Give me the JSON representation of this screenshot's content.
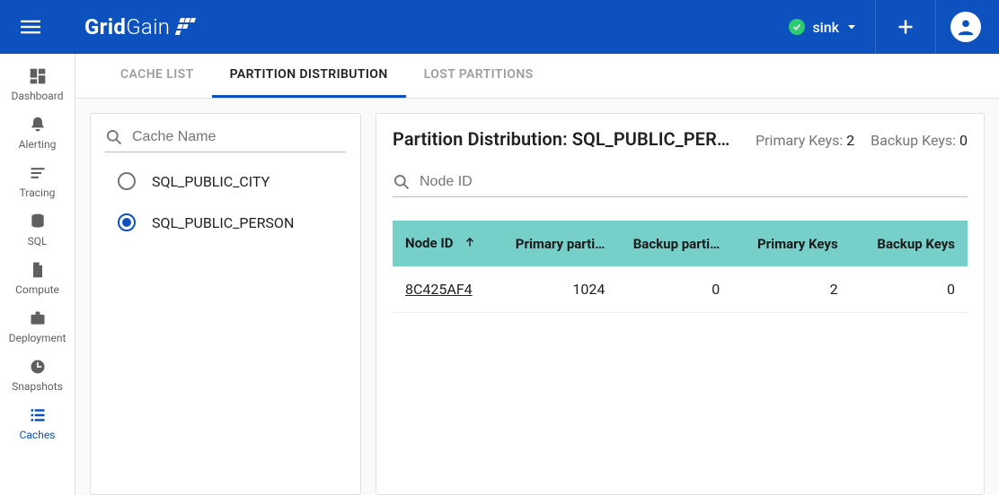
{
  "header": {
    "brand_strong": "Grid",
    "brand_light": "Gain",
    "cluster_name": "sink"
  },
  "leftnav": {
    "items": [
      {
        "label": "Dashboard",
        "icon": "dashboard"
      },
      {
        "label": "Alerting",
        "icon": "bell"
      },
      {
        "label": "Tracing",
        "icon": "lines"
      },
      {
        "label": "SQL",
        "icon": "db"
      },
      {
        "label": "Compute",
        "icon": "file"
      },
      {
        "label": "Deployment",
        "icon": "briefcase"
      },
      {
        "label": "Snapshots",
        "icon": "clock"
      },
      {
        "label": "Caches",
        "icon": "list",
        "active": true
      }
    ]
  },
  "tabs": {
    "items": [
      {
        "label": "CACHE LIST"
      },
      {
        "label": "PARTITION DISTRIBUTION",
        "active": true
      },
      {
        "label": "LOST PARTITIONS"
      }
    ]
  },
  "cache_panel": {
    "search_placeholder": "Cache Name",
    "caches": [
      {
        "name": "SQL_PUBLIC_CITY",
        "selected": false
      },
      {
        "name": "SQL_PUBLIC_PERSON",
        "selected": true
      }
    ]
  },
  "dist_panel": {
    "title": "Partition Distribution: SQL_PUBLIC_PERS…",
    "primary_keys_label": "Primary Keys:",
    "primary_keys_value": "2",
    "backup_keys_label": "Backup Keys:",
    "backup_keys_value": "0",
    "node_search_placeholder": "Node ID",
    "columns": {
      "c0": "Node ID",
      "c1": "Primary parti…",
      "c2": "Backup parti…",
      "c3": "Primary Keys",
      "c4": "Backup Keys"
    },
    "rows": [
      {
        "node_id": "8C425AF4",
        "primary_parts": "1024",
        "backup_parts": "0",
        "primary_keys": "2",
        "backup_keys": "0"
      }
    ]
  }
}
